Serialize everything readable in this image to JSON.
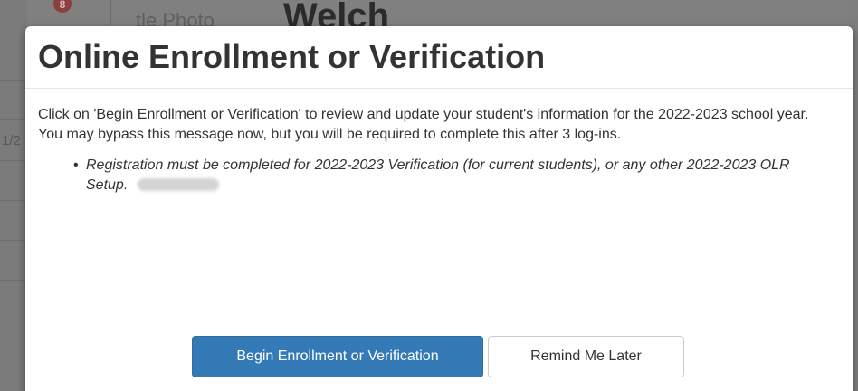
{
  "background": {
    "badge": "8",
    "header_small": "tle Photo",
    "header_large": "Welch",
    "edge_text": "1/2"
  },
  "modal": {
    "title": "Online Enrollment or Verification",
    "intro": "Click on 'Begin Enrollment or Verification' to review and update your student's information for the 2022-2023 school year. You may bypass this message now, but you will be required to complete this after 3 log-ins.",
    "notices": [
      "Registration must be completed for 2022-2023 Verification (for current students), or any other 2022-2023 OLR Setup."
    ],
    "buttons": {
      "begin_label": "Begin Enrollment or Verification",
      "remind_label": "Remind Me Later"
    }
  },
  "colors": {
    "primary_button": "#337ab7",
    "overlay": "#808080",
    "text": "#333333"
  }
}
